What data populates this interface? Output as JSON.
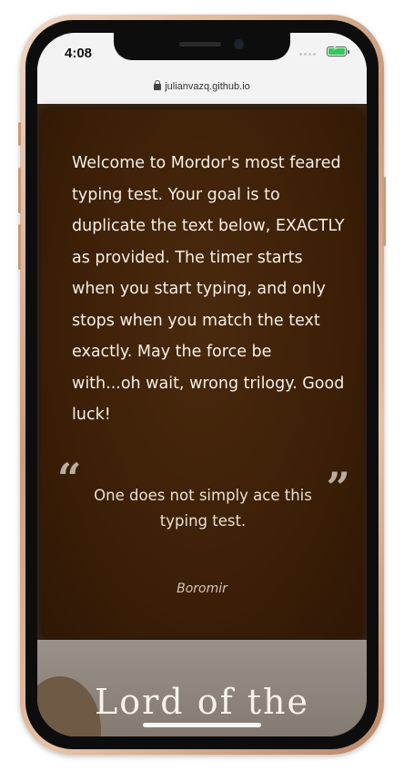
{
  "status_bar": {
    "time": "4:08",
    "battery_color": "#35c759"
  },
  "browser": {
    "url": "julianvazq.github.io",
    "lock_icon": "lock-icon"
  },
  "intro": {
    "text": "Welcome to Mordor's most feared typing test. Your goal is to duplicate the text below, EXACTLY as provided. The timer starts when you start typing, and only stops when you match the text exactly. May the force be with...oh wait, wrong trilogy. Good luck!"
  },
  "quote": {
    "open_mark": "“",
    "close_mark": "”",
    "text": "One does not simply ace this typing test.",
    "author": "Boromir"
  },
  "hero": {
    "title": "Lord of the"
  },
  "colors": {
    "card_background": "#3c1f07",
    "text": "#f4efe6",
    "frame": "#c99a7a"
  }
}
